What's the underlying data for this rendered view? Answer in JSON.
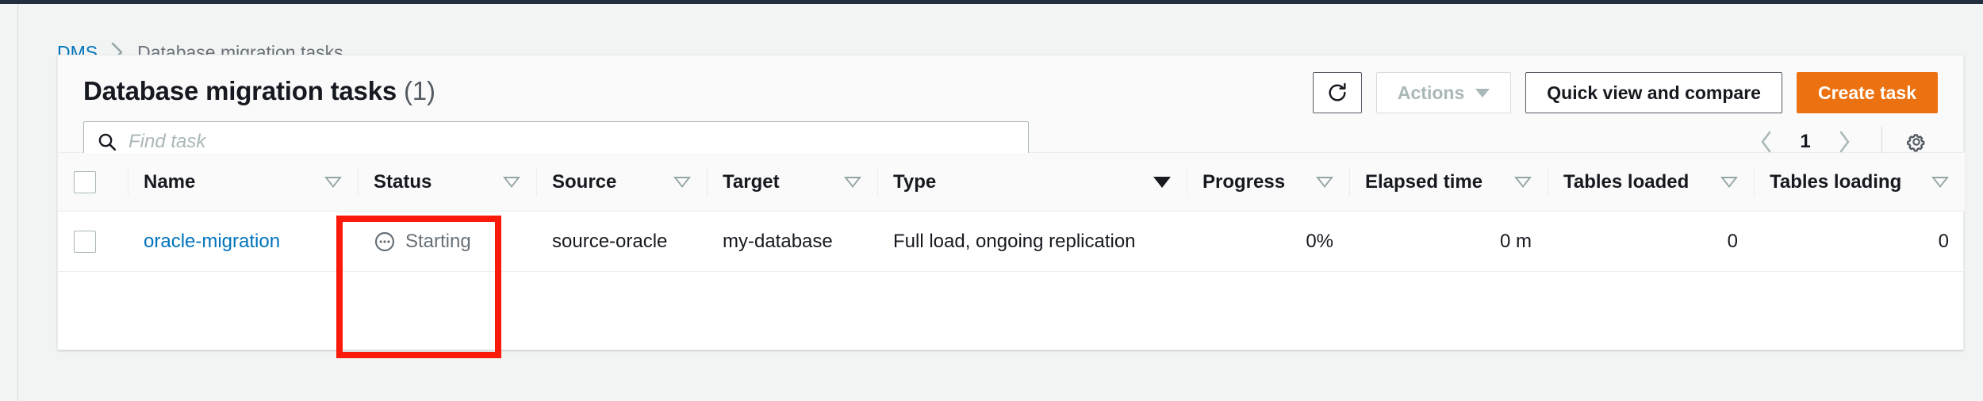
{
  "breadcrumb": {
    "root_label": "DMS",
    "separator_icon": "chevron-right-icon",
    "current_label": "Database migration tasks"
  },
  "card": {
    "title": "Database migration tasks",
    "count": "(1)"
  },
  "toolbar": {
    "refresh_icon": "refresh-icon",
    "refresh_label": "",
    "actions_label": "Actions",
    "actions_caret_icon": "caret-down-icon",
    "quick_view_label": "Quick view and compare",
    "create_task_label": "Create task"
  },
  "search": {
    "icon": "search-icon",
    "value": "",
    "placeholder": "Find task"
  },
  "pagination": {
    "prev_icon": "chevron-left-icon",
    "page_number": "1",
    "next_icon": "chevron-right-icon",
    "settings_icon": "gear-icon"
  },
  "table": {
    "select_all_icon": "checkbox-unchecked-icon",
    "columns": [
      {
        "label": "Name",
        "sort_icon": "sort-triangle-icon",
        "sorted": false,
        "align": "left"
      },
      {
        "label": "Status",
        "sort_icon": "sort-triangle-icon",
        "sorted": false,
        "align": "left"
      },
      {
        "label": "Source",
        "sort_icon": "sort-triangle-icon",
        "sorted": false,
        "align": "left"
      },
      {
        "label": "Target",
        "sort_icon": "sort-triangle-icon",
        "sorted": false,
        "align": "left"
      },
      {
        "label": "Type",
        "sort_icon": "sort-triangle-icon",
        "sorted": true,
        "align": "left"
      },
      {
        "label": "Progress",
        "sort_icon": "sort-triangle-icon",
        "sorted": false,
        "align": "left"
      },
      {
        "label": "Elapsed time",
        "sort_icon": "sort-triangle-icon",
        "sorted": false,
        "align": "left"
      },
      {
        "label": "Tables loaded",
        "sort_icon": "sort-triangle-icon",
        "sorted": false,
        "align": "left"
      },
      {
        "label": "Tables loading",
        "sort_icon": "sort-triangle-icon",
        "sorted": false,
        "align": "left"
      }
    ],
    "rows": [
      {
        "row_checkbox_icon": "checkbox-unchecked-icon",
        "name": "oracle-migration",
        "status": "Starting",
        "status_icon": "pending-dots-circle-icon",
        "source": "source-oracle",
        "target": "my-database",
        "type": "Full load, ongoing replication",
        "progress": "0%",
        "elapsed_time": "0 m",
        "tables_loaded": "0",
        "tables_loading": "0"
      }
    ]
  },
  "annotation": {
    "shape": "rectangle-highlight",
    "color": "#fb1a09",
    "targets": "status-column"
  },
  "colors": {
    "accent_orange": "#ec7211",
    "link_blue": "#0073bb",
    "top_bar": "#232f3e",
    "page_bg": "#f2f3f3",
    "annotation_red": "#fb1a09"
  }
}
